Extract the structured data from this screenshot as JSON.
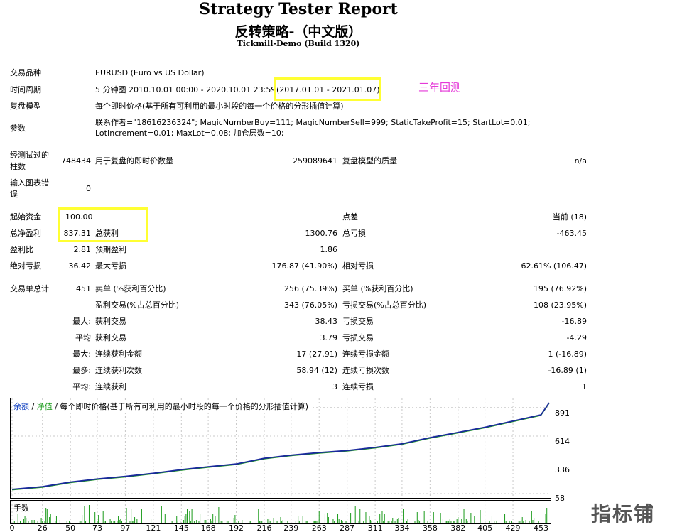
{
  "header": {
    "title": "Strategy Tester Report",
    "subtitle": "反转策略-（中文版）",
    "server": "Tickmill-Demo (Build 1320)"
  },
  "info": {
    "symbol_label": "交易品种",
    "symbol_value": "EURUSD (Euro vs US Dollar)",
    "period_label": "时间周期",
    "period_value": "5 分钟图 2010.10.01 00:00 - 2020.10.01 23:59",
    "period_highlight": "(2017.01.01 - 2021.01.07)",
    "annotation": "三年回测",
    "model_label": "复盘模型",
    "model_value": "每个即时价格(基于所有可利用的最小时段的每一个价格的分形插值计算)",
    "params_label": "参数",
    "params_line1": "联系作者=\"18616236324\"; MagicNumberBuy=111; MagicNumberSell=999; StaticTakeProfit=15; StartLot=0.01;",
    "params_line2": "LotIncrement=0.01; MaxLot=0.08; 加仓层数=10;"
  },
  "bars": {
    "bars_label_1": "经测试过的",
    "bars_label_2": "柱数",
    "bars_value": "748434",
    "ticks_label": "用于复盘的即时价数量",
    "ticks_value": "259089641",
    "quality_label": "复盘模型的质量",
    "quality_value": "n/a",
    "errors_label_1": "输入图表错",
    "errors_label_2": "误",
    "errors_value": "0"
  },
  "stats": {
    "deposit_label": "起始资金",
    "deposit_value": "100.00",
    "spread_label": "点差",
    "spread_value": "当前 (18)",
    "net_label": "总净盈利",
    "net_value": "837.31",
    "gross_profit_label": "总获利",
    "gross_profit_value": "1300.76",
    "gross_loss_label": "总亏损",
    "gross_loss_value": "-463.45",
    "pf_label": "盈利比",
    "pf_value": "2.81",
    "payoff_label": "预期盈利",
    "payoff_value": "1.86",
    "abs_dd_label": "绝对亏损",
    "abs_dd_value": "36.42",
    "max_dd_label": "最大亏损",
    "max_dd_value": "176.87 (41.90%)",
    "rel_dd_label": "相对亏损",
    "rel_dd_value": "62.61% (106.47)"
  },
  "trades": {
    "total_label": "交易单总计",
    "total_value": "451",
    "short_label": "卖单 (%获利百分比)",
    "short_value": "256 (75.39%)",
    "long_label": "买单 (%获利百分比)",
    "long_value": "195 (76.92%)",
    "profit_trades_label": "盈利交易(%占总百分比)",
    "profit_trades_value": "343 (76.05%)",
    "loss_trades_label": "亏损交易(%占总百分比)",
    "loss_trades_value": "108 (23.95%)",
    "largest_prefix": "最大:",
    "largest_profit_label": "获利交易",
    "largest_profit_value": "38.43",
    "largest_loss_label": "亏损交易",
    "largest_loss_value": "-16.89",
    "average_prefix": "平均",
    "average_profit_label": "获利交易",
    "average_profit_value": "3.79",
    "average_loss_label": "亏损交易",
    "average_loss_value": "-4.29",
    "max_amount_prefix": "最大:",
    "max_consec_wins_label": "连续获利金额",
    "max_consec_wins_value": "17 (27.91)",
    "max_consec_losses_label": "连续亏损金额",
    "max_consec_losses_value": "1 (-16.89)",
    "max_count_prefix": "最多:",
    "max_consec_profit_label": "连续获利次数",
    "max_consec_profit_value": "58.94 (12)",
    "max_consec_loss_label": "连续亏损次数",
    "max_consec_loss_value": "-16.89 (1)",
    "avg_consec_prefix": "平均:",
    "avg_consec_wins_label": "连续获利",
    "avg_consec_wins_value": "3",
    "avg_consec_losses_label": "连续亏损",
    "avg_consec_losses_value": "1"
  },
  "chart": {
    "legend_balance": "余额",
    "legend_sep": " / ",
    "legend_equity": "净值",
    "legend_rest": " / 每个即时价格(基于所有可利用的最小时段的每一个价格的分形插值计算)",
    "volume_label": "手数",
    "watermark": "指标铺"
  },
  "chart_data": {
    "type": "line",
    "series": [
      {
        "name": "余额",
        "color": "#1a2a9c"
      },
      {
        "name": "净值",
        "color": "#1a9a1a"
      }
    ],
    "y_ticks": [
      891,
      614,
      336,
      58
    ],
    "ylim": [
      58,
      937
    ],
    "x_ticks": [
      0,
      26,
      50,
      73,
      97,
      121,
      145,
      168,
      192,
      216,
      239,
      263,
      287,
      311,
      334,
      358,
      382,
      405,
      429,
      453
    ],
    "xlim": [
      0,
      460
    ],
    "x": [
      0,
      26,
      50,
      73,
      97,
      121,
      145,
      168,
      192,
      216,
      239,
      263,
      287,
      311,
      334,
      358,
      382,
      405,
      429,
      453,
      460
    ],
    "balance": [
      100,
      125,
      170,
      200,
      225,
      255,
      290,
      318,
      345,
      400,
      430,
      455,
      475,
      505,
      540,
      600,
      650,
      700,
      760,
      820,
      937
    ],
    "volume_color": "#1a9a1a",
    "grid": true
  }
}
